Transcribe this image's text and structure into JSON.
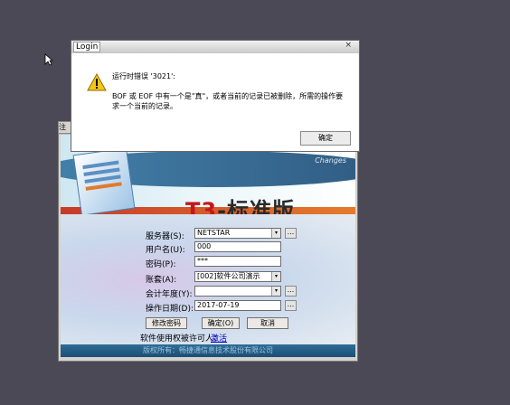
{
  "background_window": {
    "tab_label": "注",
    "banner_tag": "Changes",
    "product_logo_prefix": "T3",
    "product_logo_suffix": "-标准版",
    "form": {
      "server_label": "服务器(S):",
      "server_value": "NETSTAR",
      "username_label": "用户名(U):",
      "username_value": "000",
      "password_label": "密码(P):",
      "password_value": "***",
      "account_label": "账套(A):",
      "account_value": "[002]软件公司演示",
      "fiscal_year_label": "会计年度(Y):",
      "fiscal_year_value": "",
      "operation_date_label": "操作日期(D):",
      "operation_date_value": "2017-07-19",
      "browse_label": "..."
    },
    "buttons": {
      "change_password": "修改密码",
      "confirm": "确定(O)",
      "cancel": "取消"
    },
    "license_text": "软件使用权被许可人：",
    "license_link": "激活",
    "footer": "版权所有：畅捷通信息技术股份有限公司"
  },
  "dialog": {
    "title": "Login",
    "close_glyph": "×",
    "error_line1": "运行时错误 '3021':",
    "error_line2": "BOF 或 EOF 中有一个是\"真\"，或者当前的记录已被删除，所需的操作要求一个当前的记录。",
    "ok_label": "确定"
  },
  "icons": [
    "warning-icon",
    "dropdown-arrow-icon",
    "mouse-cursor-icon"
  ],
  "colors": {
    "desktop": "#4a4955",
    "logo_red": "#c4171b",
    "footer_blue": "#1b4e76",
    "warning_yellow": "#f5c518"
  }
}
